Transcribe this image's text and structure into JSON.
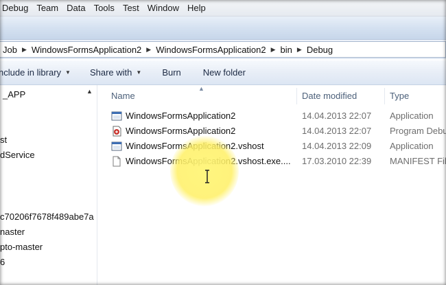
{
  "menu": [
    "Debug",
    "Team",
    "Data",
    "Tools",
    "Test",
    "Window",
    "Help"
  ],
  "address": {
    "crumbs": [
      "Job",
      "WindowsFormsApplication2",
      "WindowsFormsApplication2",
      "bin",
      "Debug"
    ]
  },
  "commands": {
    "include_in_library": "nclude in library",
    "share_with": "Share with",
    "burn": "Burn",
    "new_folder": "New folder"
  },
  "nav": {
    "items": [
      "_APP",
      "st",
      "dService",
      "c70206f7678f489abe7a",
      "naster",
      "pto-master",
      "6"
    ]
  },
  "columns": {
    "name": "Name",
    "date_modified": "Date modified",
    "type": "Type"
  },
  "files": [
    {
      "name": "WindowsFormsApplication2",
      "date": "14.04.2013 22:07",
      "type": "Application",
      "icon": "exe-icon"
    },
    {
      "name": "WindowsFormsApplication2",
      "date": "14.04.2013 22:07",
      "type": "Program Debug",
      "icon": "pdb-icon"
    },
    {
      "name": "WindowsFormsApplication2.vshost",
      "date": "14.04.2013 22:09",
      "type": "Application",
      "icon": "exe-icon"
    },
    {
      "name": "WindowsFormsApplication2.vshost.exe....",
      "date": "17.03.2010 22:39",
      "type": "MANIFEST File",
      "icon": "manifest-file-icon"
    }
  ],
  "colors": {
    "highlight": "#fff36e",
    "column_header_text": "#4c607a",
    "secondary_text": "#6d6d6d"
  }
}
